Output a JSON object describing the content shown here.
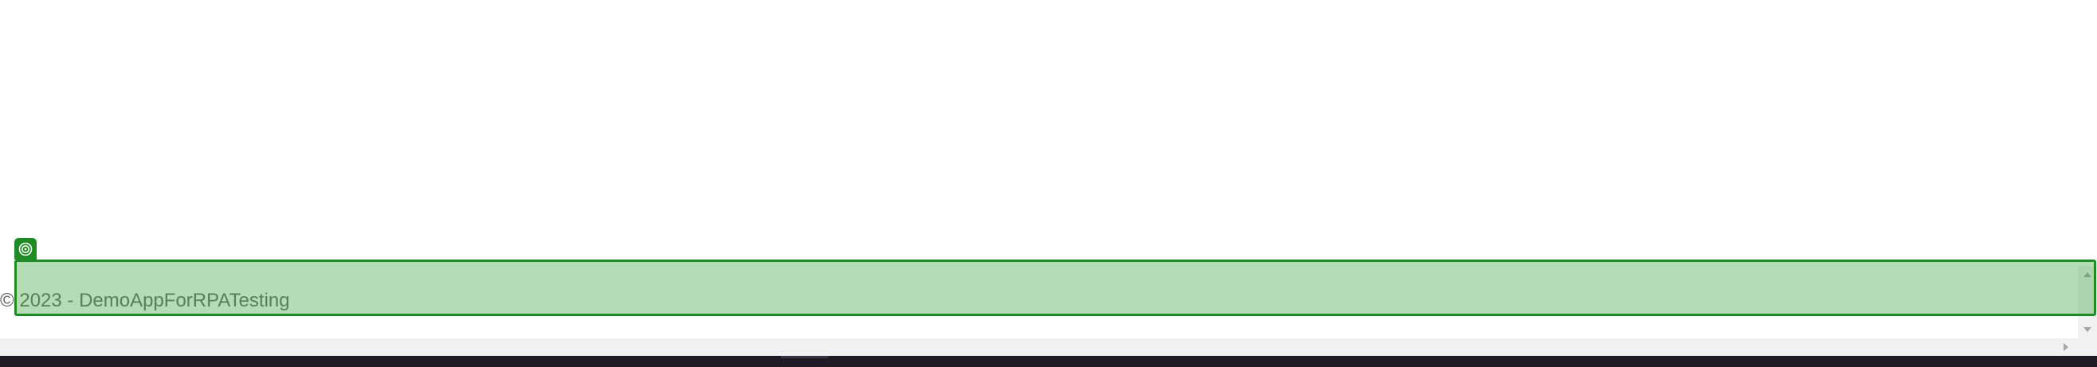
{
  "footer": {
    "copyright": "© 2023 - DemoAppForRPATesting"
  },
  "highlight": {
    "badge_icon": "target-icon",
    "fill_color": "#4caf50",
    "border_color": "#1e8b24"
  },
  "scrollbars": {
    "up_icon": "scroll-up-arrow-icon",
    "down_icon": "scroll-down-arrow-icon",
    "right_icon": "scroll-right-arrow-icon"
  },
  "taskbar": {
    "background": "#1f1b24"
  }
}
